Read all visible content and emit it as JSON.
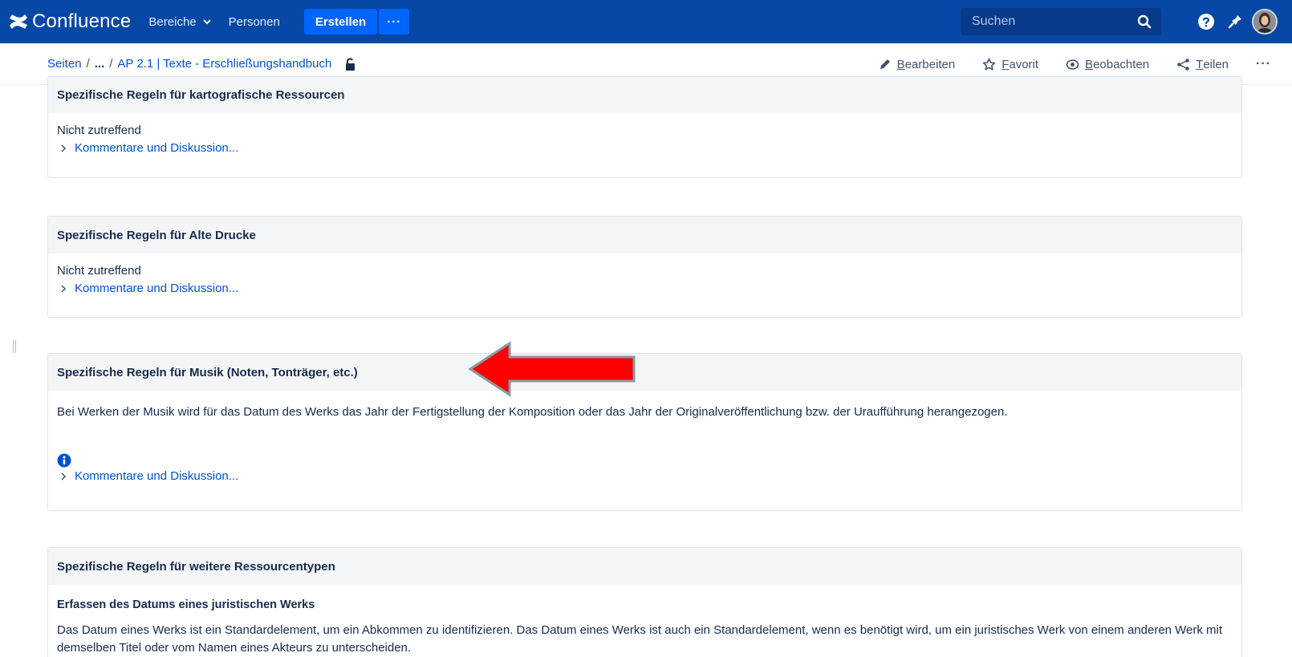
{
  "topbar": {
    "logo_text": "Confluence",
    "nav_spaces": "Bereiche",
    "nav_people": "Personen",
    "create_label": "Erstellen",
    "more_label": "···",
    "search_placeholder": "Suchen"
  },
  "breadcrumb": {
    "pages": "Seiten",
    "sep1": "/",
    "ellipsis": "...",
    "sep2": "/",
    "current": "AP 2.1 | Texte - Erschließungshandbuch"
  },
  "actions": {
    "edit_first": "B",
    "edit_rest": "earbeiten",
    "favorite_first": "F",
    "favorite_rest": "avorit",
    "watch_first": "B",
    "watch_rest": "eobachten",
    "share_first": "T",
    "share_rest": "eilen",
    "more": "···"
  },
  "panels": [
    {
      "title": "Spezifische Regeln für kartografische Ressourcen",
      "text": "Nicht zutreffend",
      "link": "Kommentare und Diskussion..."
    },
    {
      "title": "Spezifische Regeln für Alte Drucke",
      "text": "Nicht zutreffend",
      "link": "Kommentare und Diskussion..."
    },
    {
      "title": "Spezifische Regeln für Musik (Noten, Tonträger, etc.)",
      "text": "Bei Werken der Musik wird für das Datum des Werks das Jahr der Fertigstellung der Komposition oder das Jahr der Originalveröffentlichung bzw. der Uraufführung herangezogen.",
      "link": "Kommentare und Diskussion..."
    },
    {
      "title": "Spezifische Regeln für weitere Ressourcentypen",
      "subheading": "Erfassen des Datums eines juristischen Werks",
      "text": "Das Datum eines Werks ist ein Standardelement, um ein Abkommen zu identifizieren. Das Datum eines Werks ist auch ein Standardelement, wenn es benötigt wird, um ein juristisches Werk von einem anderen Werk mit demselben Titel oder vom Namen eines Akteurs zu unterscheiden."
    }
  ],
  "colors": {
    "topbar": "#0747a6",
    "create_button": "#0065ff",
    "link": "#0052cc",
    "panel_header": "#f4f5f7",
    "arrow": "#ff0000"
  },
  "icons": [
    "confluence-logo-icon",
    "chevron-down-icon",
    "search-icon",
    "help-icon",
    "notification-icon",
    "lock-icon",
    "pencil-icon",
    "star-icon",
    "eye-icon",
    "share-icon",
    "chevron-right-icon",
    "info-icon",
    "red-arrow"
  ]
}
